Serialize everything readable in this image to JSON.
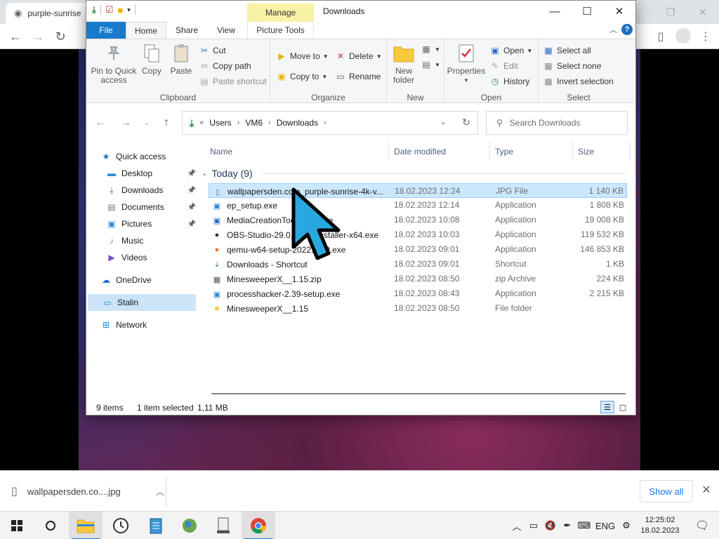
{
  "browser": {
    "tab_title": "purple-sunrise",
    "download": {
      "filename": "wallpapersden.co....jpg",
      "show_all": "Show all"
    }
  },
  "explorer": {
    "title": "Downloads",
    "manage_label": "Manage",
    "tabs": {
      "file": "File",
      "home": "Home",
      "share": "Share",
      "view": "View",
      "picture_tools": "Picture Tools"
    },
    "ribbon": {
      "clipboard": {
        "label": "Clipboard",
        "pin": "Pin to Quick access",
        "copy": "Copy",
        "paste": "Paste",
        "cut": "Cut",
        "copy_path": "Copy path",
        "paste_shortcut": "Paste shortcut"
      },
      "organize": {
        "label": "Organize",
        "move_to": "Move to",
        "copy_to": "Copy to",
        "delete": "Delete",
        "rename": "Rename"
      },
      "new": {
        "label": "New",
        "new_folder": "New folder"
      },
      "open": {
        "label": "Open",
        "properties": "Properties",
        "open": "Open",
        "edit": "Edit",
        "history": "History"
      },
      "select": {
        "label": "Select",
        "select_all": "Select all",
        "select_none": "Select none",
        "invert": "Invert selection"
      }
    },
    "address": {
      "crumbs": [
        "Users",
        "VM6",
        "Downloads"
      ],
      "search_placeholder": "Search Downloads"
    },
    "nav": [
      {
        "label": "Quick access",
        "icon": "star-icon",
        "pinned": false
      },
      {
        "label": "Desktop",
        "icon": "desktop-icon",
        "pinned": true
      },
      {
        "label": "Downloads",
        "icon": "download-icon",
        "pinned": true
      },
      {
        "label": "Documents",
        "icon": "documents-icon",
        "pinned": true
      },
      {
        "label": "Pictures",
        "icon": "pictures-icon",
        "pinned": true
      },
      {
        "label": "Music",
        "icon": "music-icon",
        "pinned": false
      },
      {
        "label": "Videos",
        "icon": "videos-icon",
        "pinned": false
      },
      {
        "label": "OneDrive",
        "icon": "cloud-icon",
        "pinned": false
      },
      {
        "label": "Stalin",
        "icon": "pc-icon",
        "pinned": false
      },
      {
        "label": "Network",
        "icon": "network-icon",
        "pinned": false
      }
    ],
    "columns": {
      "name": "Name",
      "date": "Date modified",
      "type": "Type",
      "size": "Size"
    },
    "group": "Today (9)",
    "files": [
      {
        "name": "wallpapersden.com_purple-sunrise-4k-v...",
        "date": "18.02.2023 12:24",
        "type": "JPG File",
        "size": "1 140 KB",
        "icon": "image-file-icon"
      },
      {
        "name": "ep_setup.exe",
        "date": "18.02.2023 12:14",
        "type": "Application",
        "size": "1 808 KB",
        "icon": "installer-icon"
      },
      {
        "name": "MediaCreationTool22H2.exe",
        "date": "18.02.2023 10:08",
        "type": "Application",
        "size": "19 008 KB",
        "icon": "windows-installer-icon"
      },
      {
        "name": "OBS-Studio-29.0.2-Full-Installer-x64.exe",
        "date": "18.02.2023 10:03",
        "type": "Application",
        "size": "119 532 KB",
        "icon": "obs-icon"
      },
      {
        "name": "qemu-w64-setup-20221230.exe",
        "date": "18.02.2023 09:01",
        "type": "Application",
        "size": "146 853 KB",
        "icon": "qemu-icon"
      },
      {
        "name": "Downloads - Shortcut",
        "date": "18.02.2023 09:01",
        "type": "Shortcut",
        "size": "1 KB",
        "icon": "shortcut-icon"
      },
      {
        "name": "MinesweeperX__1.15.zip",
        "date": "18.02.2023 08:50",
        "type": "zip Archive",
        "size": "224 KB",
        "icon": "zip-icon"
      },
      {
        "name": "processhacker-2.39-setup.exe",
        "date": "18.02.2023 08:43",
        "type": "Application",
        "size": "2 215 KB",
        "icon": "installer-icon"
      },
      {
        "name": "MinesweeperX__1.15",
        "date": "18.02.2023 08:50",
        "type": "File folder",
        "size": "",
        "icon": "folder-icon"
      }
    ],
    "status": {
      "count": "9 items",
      "selected": "1 item selected",
      "size": "1,11 MB"
    }
  },
  "taskbar": {
    "lang": "ENG",
    "time": "12:25:02",
    "date": "18.02.2023"
  }
}
